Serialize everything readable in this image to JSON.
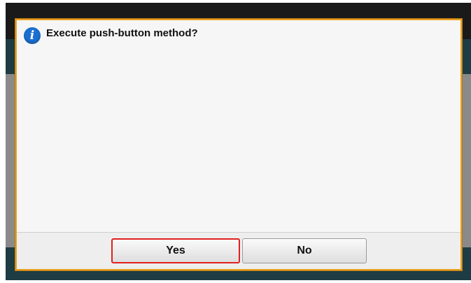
{
  "dialog": {
    "message": "Execute push-button method?",
    "icon": "info-icon",
    "icon_glyph": "i",
    "accent_color": "#e8a020",
    "selected_border_color": "#e02020"
  },
  "buttons": {
    "yes_label": "Yes",
    "no_label": "No",
    "selected": "Yes"
  }
}
